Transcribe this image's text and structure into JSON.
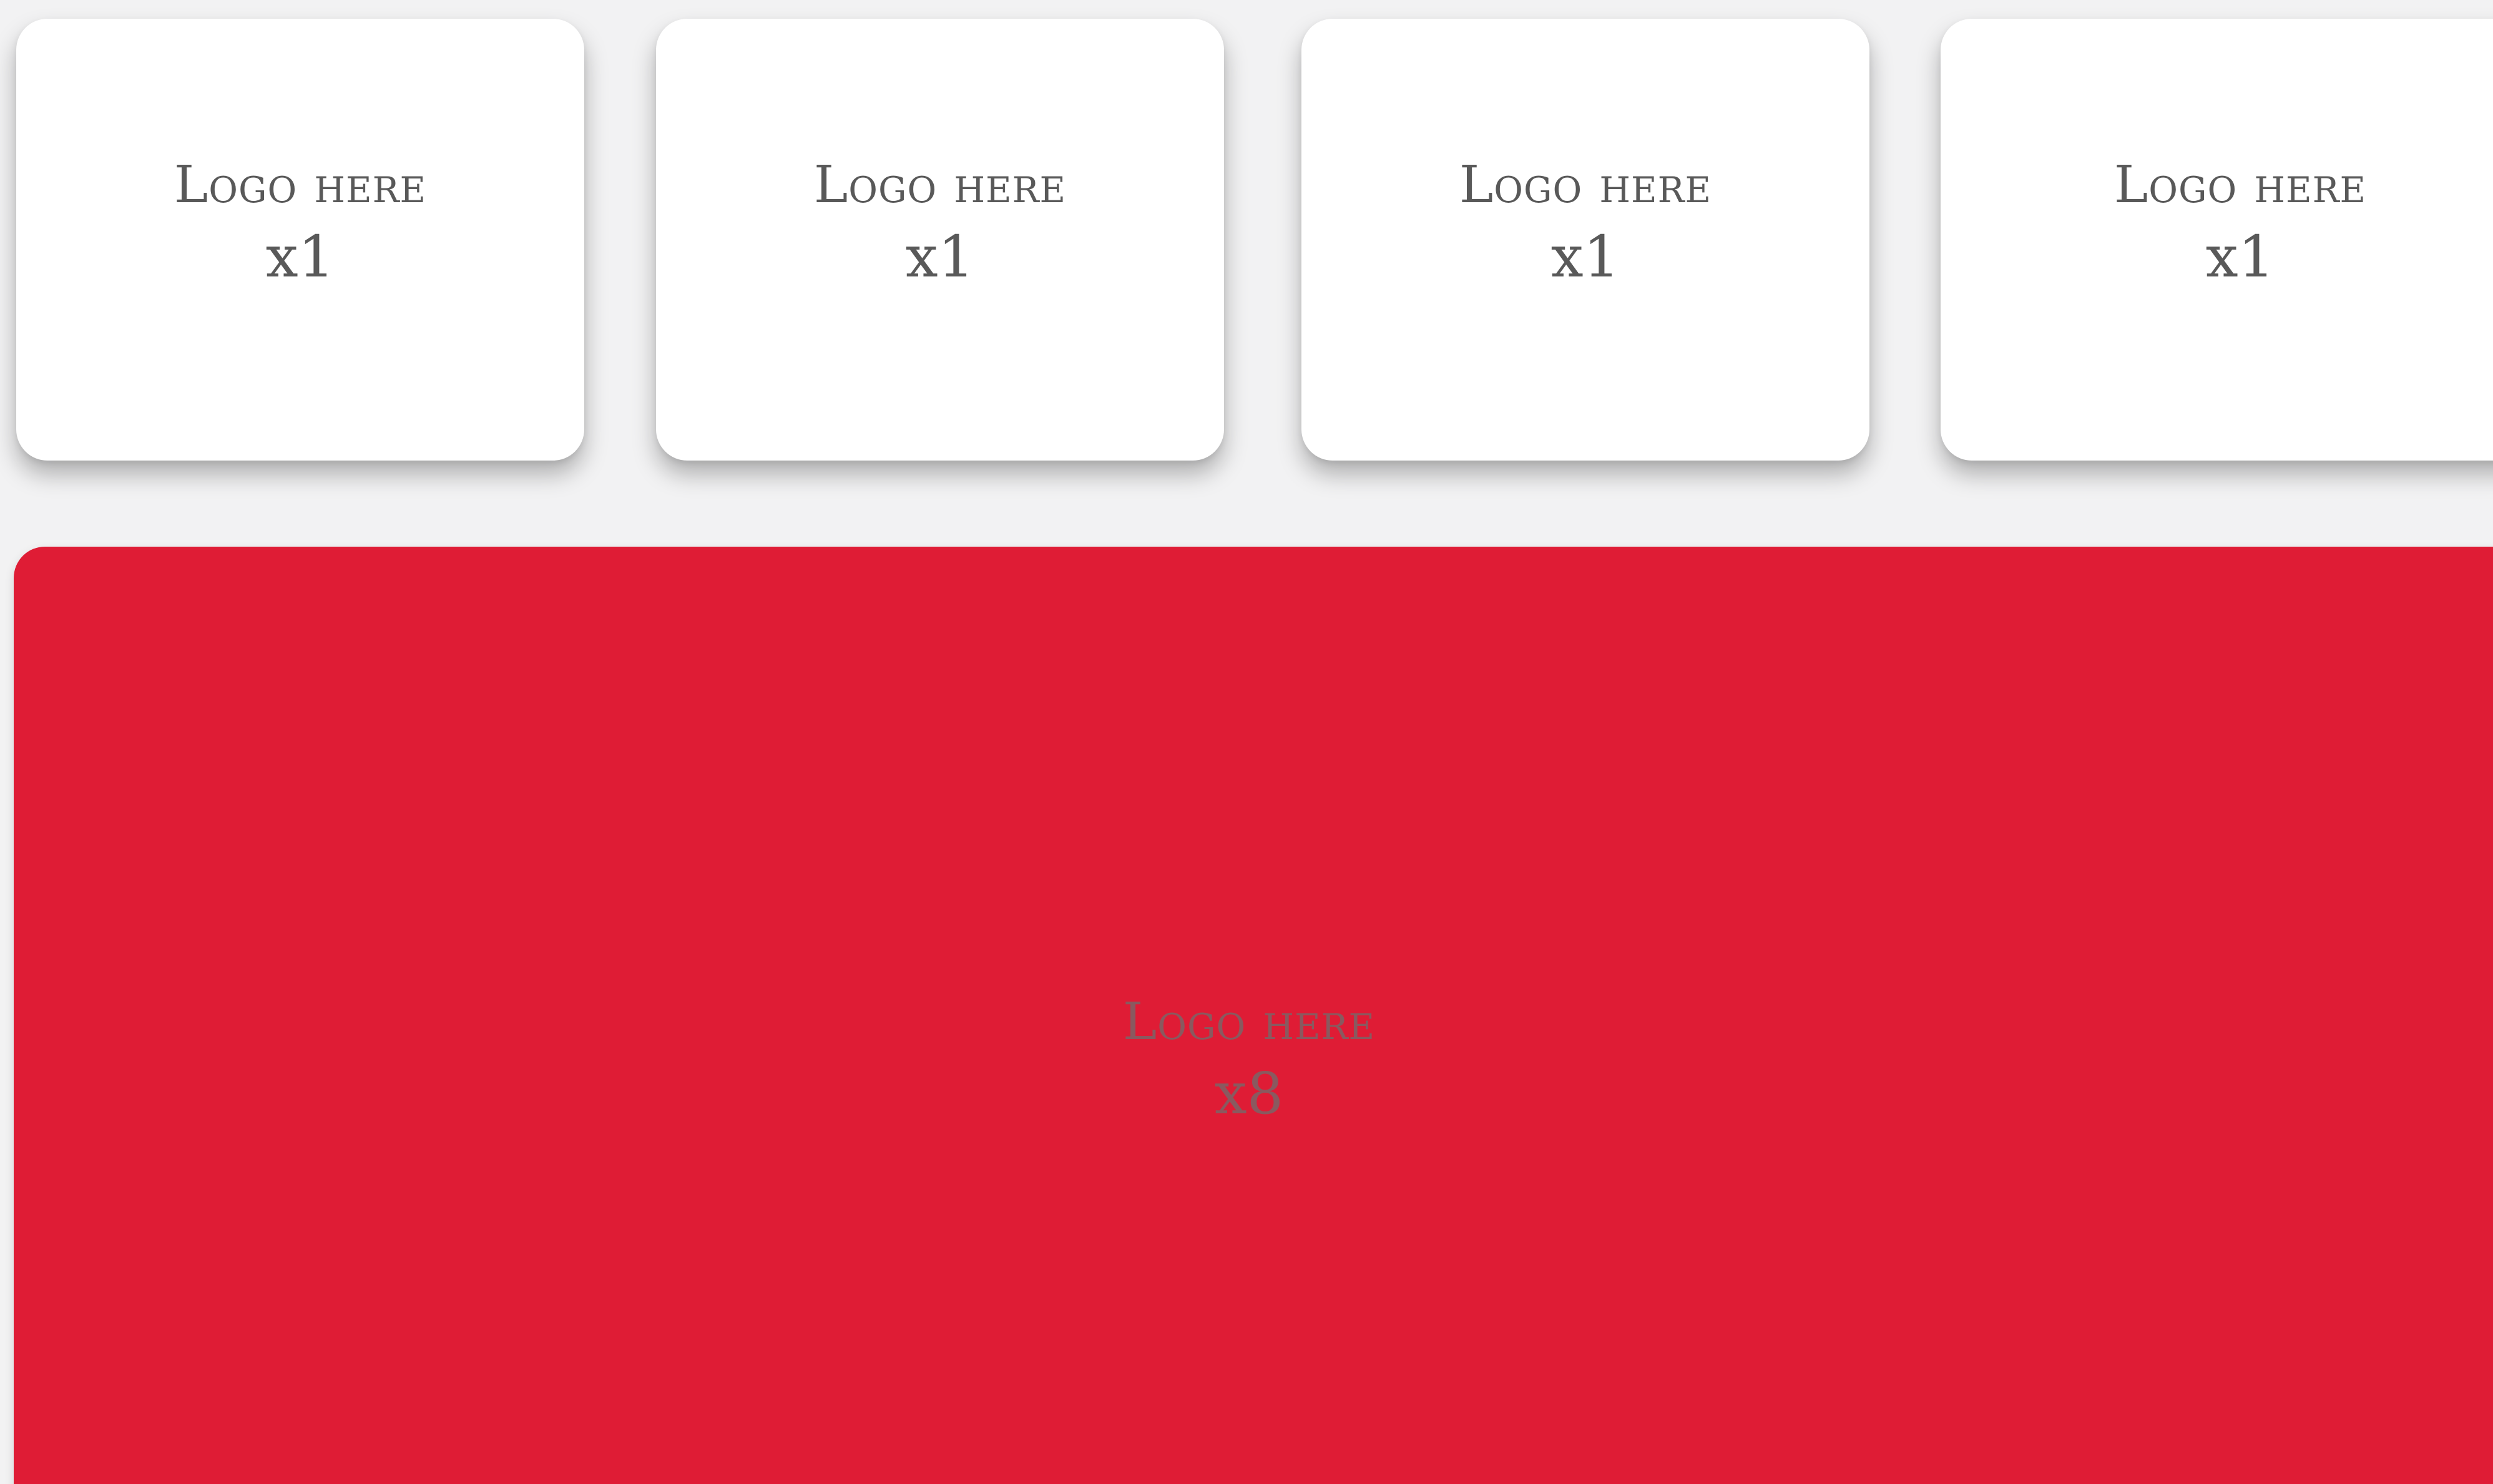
{
  "colors": {
    "page_background": "#f2f2f3",
    "tile_background": "#ffffff",
    "tile_text": "#595959",
    "banner_background": "#df1c35",
    "banner_text": "#6e6e6e"
  },
  "tiles": [
    {
      "title": "Logo here",
      "multiplier": "x1"
    },
    {
      "title": "Logo here",
      "multiplier": "x1"
    },
    {
      "title": "Logo here",
      "multiplier": "x1"
    },
    {
      "title": "Logo here",
      "multiplier": "x1"
    }
  ],
  "banner": {
    "title": "Logo here",
    "multiplier": "x8"
  }
}
